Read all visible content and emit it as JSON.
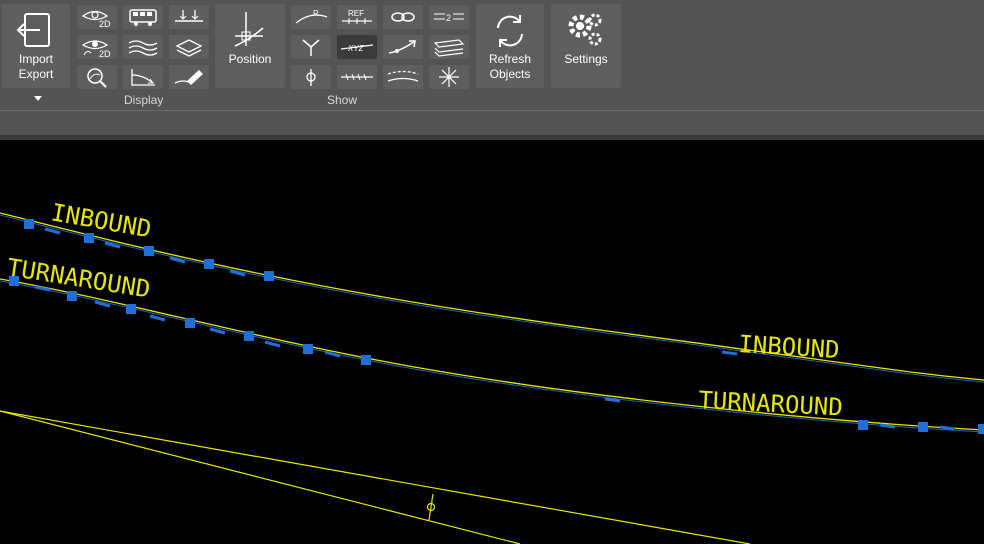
{
  "ribbon": {
    "import_export": {
      "label_line1": "Import",
      "label_line2": "Export",
      "icon": "import-export-icon"
    },
    "position": {
      "label": "Position",
      "icon": "position-icon"
    },
    "refresh": {
      "label_line1": "Refresh",
      "label_line2": "Objects",
      "icon": "refresh-icon"
    },
    "settings": {
      "label": "Settings",
      "icon": "gears-icon"
    },
    "groups": {
      "display": "Display",
      "show": "Show"
    },
    "display_tools": [
      {
        "name": "eye-2d-icon",
        "text": "2D"
      },
      {
        "name": "bus-icon"
      },
      {
        "name": "arrows-down-icon"
      },
      {
        "name": "eye-2d-alt-icon",
        "text": "2D"
      },
      {
        "name": "wavy-lines-icon"
      },
      {
        "name": "layered-plates-icon"
      },
      {
        "name": "zoom-search-icon"
      },
      {
        "name": "curve-axes-icon"
      },
      {
        "name": "eraser-pen-icon"
      }
    ],
    "show_tools": [
      {
        "name": "curve-r-icon",
        "text": "R"
      },
      {
        "name": "ref-line-icon",
        "text": "REF"
      },
      {
        "name": "chain-link-icon"
      },
      {
        "name": "double-line-2-icon",
        "text": "2"
      },
      {
        "name": "y-junction-icon"
      },
      {
        "name": "xyz-line-icon",
        "text": "XYZ",
        "active": true
      },
      {
        "name": "diagonal-arrow-icon"
      },
      {
        "name": "stacked-layers-icon"
      },
      {
        "name": "circle-bar-icon"
      },
      {
        "name": "hatched-line-icon"
      },
      {
        "name": "dashed-curve-icon"
      },
      {
        "name": "star-burst-icon"
      }
    ]
  },
  "canvas": {
    "labels": {
      "inbound_left": "INBOUND",
      "turnaround_left": "TURNAROUND",
      "inbound_right": "INBOUND",
      "turnaround_right": "TURNAROUND"
    },
    "colors": {
      "background": "#000000",
      "alignment": "#e6e600",
      "tangent_blue": "#1f6fd6",
      "label": "#e6e600"
    }
  }
}
